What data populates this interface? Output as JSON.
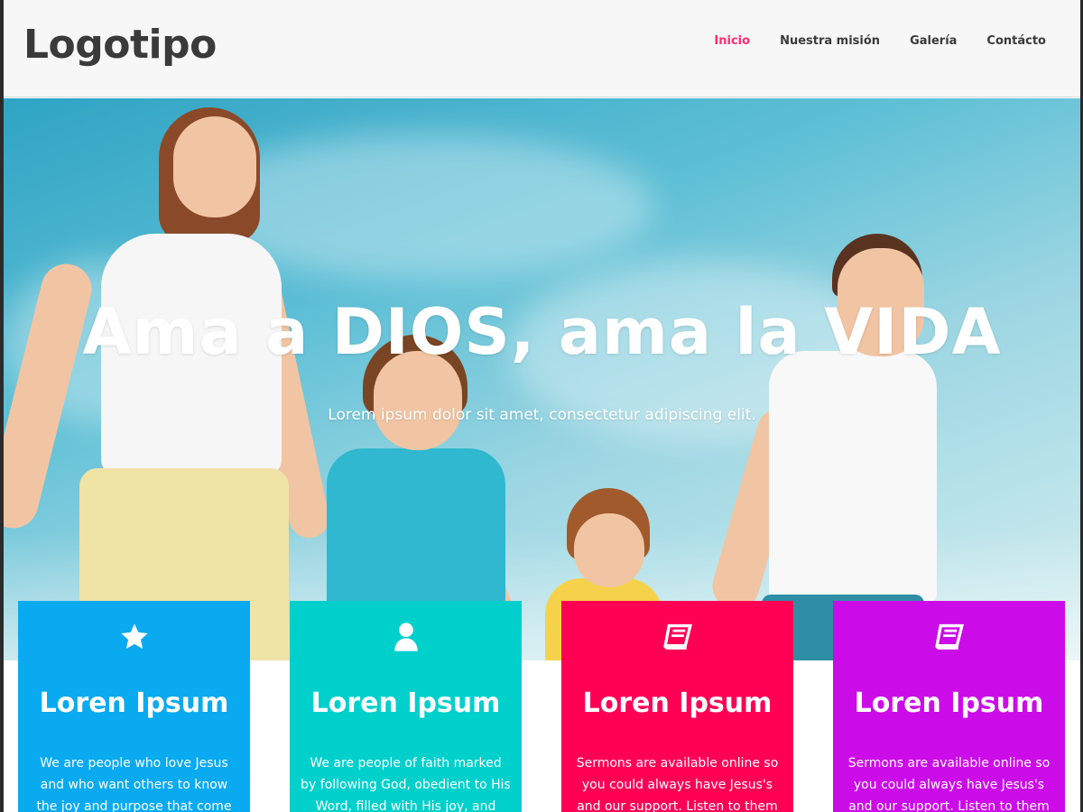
{
  "header": {
    "logo": "Logotipo",
    "nav": [
      {
        "label": "Inicio",
        "active": true
      },
      {
        "label": "Nuestra misión",
        "active": false
      },
      {
        "label": "Galería",
        "active": false
      },
      {
        "label": "Contácto",
        "active": false
      }
    ]
  },
  "hero": {
    "title": "Ama a DIOS, ama la VIDA",
    "subtitle": "Lorem ipsum dolor sit amet, consectetur adipiscing elit."
  },
  "cards": [
    {
      "icon": "star-icon",
      "title": "Loren Ipsum",
      "text": "We are people who love Jesus and who want others to know the joy and purpose that come with",
      "color": "#0aaaf0"
    },
    {
      "icon": "user-icon",
      "title": "Loren Ipsum",
      "text": "We are people of faith marked by following God, obedient to His Word, filled with His joy, and united",
      "color": "#00d0cc"
    },
    {
      "icon": "book-icon",
      "title": "Loren Ipsum",
      "text": "Sermons are available online so you could always have Jesus's and our support. Listen to them and",
      "color": "#ff0055"
    },
    {
      "icon": "book-icon",
      "title": "Loren Ipsum",
      "text": "Sermons are available online so you could always have Jesus's and our support. Listen to them and",
      "color": "#cc0ce8"
    }
  ],
  "colors": {
    "accent": "#ff2d6f",
    "text_dark": "#3a3a3a"
  }
}
